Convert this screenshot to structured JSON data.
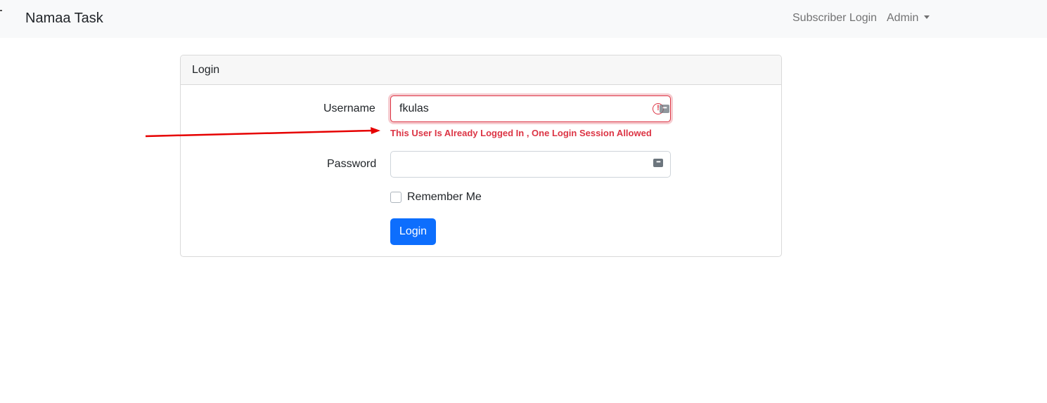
{
  "navbar": {
    "brand": "Namaa Task",
    "links": {
      "subscriber_login": "Subscriber Login",
      "admin": "Admin"
    }
  },
  "login_card": {
    "header": "Login",
    "username": {
      "label": "Username",
      "value": "fkulas",
      "error": "This User Is Already Logged In , One Login Session Allowed"
    },
    "password": {
      "label": "Password",
      "value": ""
    },
    "remember_me": {
      "label": "Remember Me",
      "checked": false
    },
    "submit_label": "Login"
  },
  "icons": [
    "exclamation-circle-icon",
    "password-key-icon",
    "chevron-down-icon",
    "annotation-arrow"
  ],
  "colors": {
    "navbar_bg": "#f8f9fa",
    "primary": "#0d6efd",
    "error": "#dc3545",
    "annotation_arrow": "#e60000"
  }
}
